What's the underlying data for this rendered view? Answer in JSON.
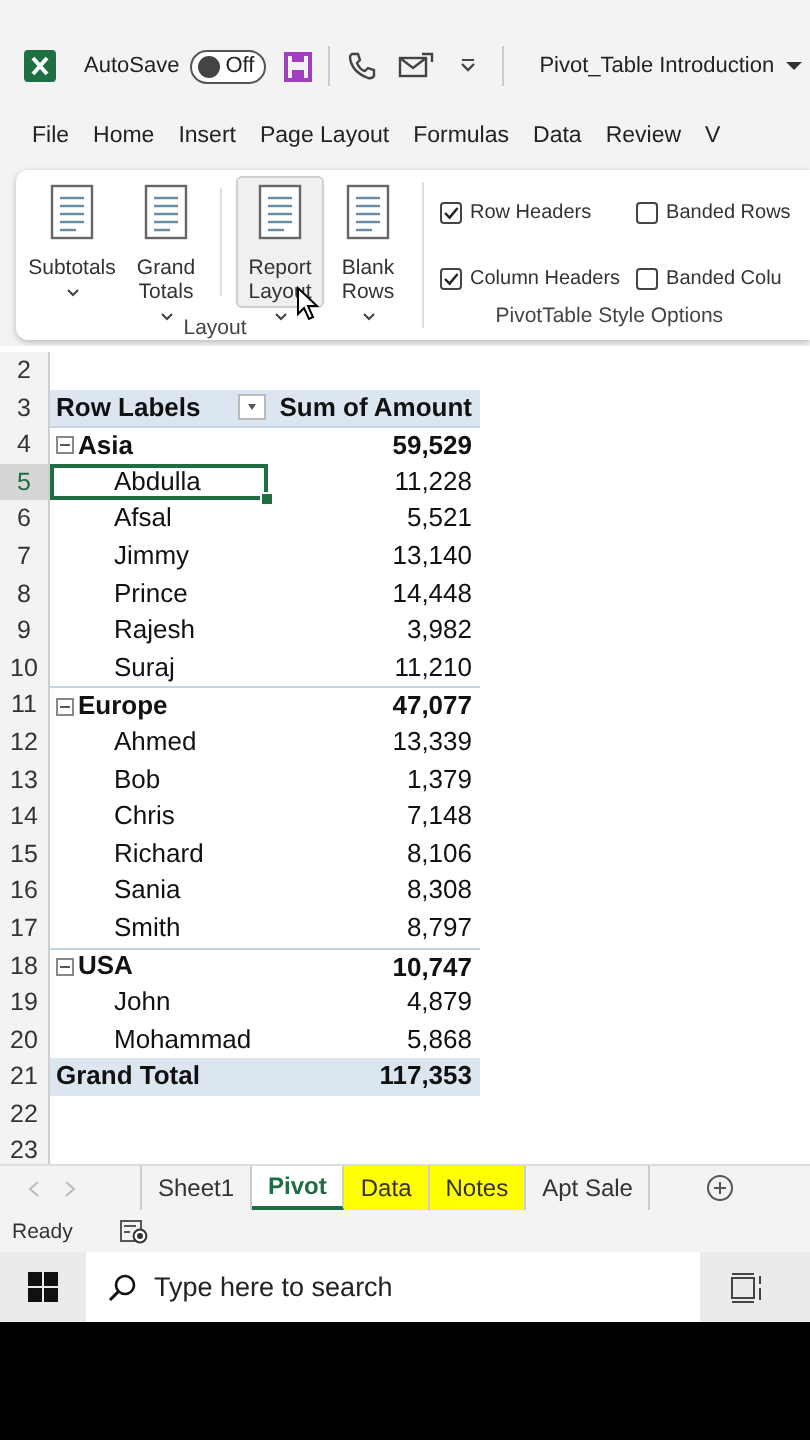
{
  "title_bar": {
    "autosave_label": "AutoSave",
    "autosave": {
      "on": false,
      "label": "Off"
    },
    "title": "Pivot_Table Introduction"
  },
  "menu_tabs": [
    {
      "label": "File",
      "selected": false
    },
    {
      "label": "Home",
      "selected": false
    },
    {
      "label": "Insert",
      "selected": false
    },
    {
      "label": "Page Layout",
      "selected": false
    },
    {
      "label": "Formulas",
      "selected": false
    },
    {
      "label": "Data",
      "selected": false
    },
    {
      "label": "Review",
      "selected": false
    },
    {
      "label": "V",
      "selected": false
    }
  ],
  "ribbon": {
    "layout_group": {
      "label": "Layout",
      "buttons": [
        {
          "label": "Subtotals",
          "highlighted": false
        },
        {
          "label": "Grand Totals",
          "highlighted": false
        },
        {
          "label": "Report Layout",
          "highlighted": true
        },
        {
          "label": "Blank Rows",
          "highlighted": false
        }
      ]
    },
    "style_group": {
      "label": "PivotTable Style Options",
      "options": [
        {
          "label": "Row Headers",
          "checked": true
        },
        {
          "label": "Banded Rows",
          "checked": false
        },
        {
          "label": "Column Headers",
          "checked": true
        },
        {
          "label": "Banded Colu",
          "checked": false
        }
      ]
    }
  },
  "sheet": {
    "rows": [
      {
        "number": "2",
        "kind": "blank",
        "selected": false
      },
      {
        "number": "3",
        "kind": "header",
        "label": "Row Labels",
        "value": "Sum of Amount",
        "selected": false
      },
      {
        "number": "4",
        "kind": "group",
        "label": "Asia",
        "value": "59,529",
        "expanded": true,
        "selected": false
      },
      {
        "number": "5",
        "kind": "item",
        "label": "Abdulla",
        "value": "11,228",
        "selected": true
      },
      {
        "number": "6",
        "kind": "item",
        "label": "Afsal",
        "value": "5,521",
        "selected": false
      },
      {
        "number": "7",
        "kind": "item",
        "label": "Jimmy",
        "value": "13,140",
        "selected": false
      },
      {
        "number": "8",
        "kind": "item",
        "label": "Prince",
        "value": "14,448",
        "selected": false
      },
      {
        "number": "9",
        "kind": "item",
        "label": "Rajesh",
        "value": "3,982",
        "selected": false
      },
      {
        "number": "10",
        "kind": "item",
        "label": "Suraj",
        "value": "11,210",
        "selected": false
      },
      {
        "number": "11",
        "kind": "group",
        "label": "Europe",
        "value": "47,077",
        "expanded": true,
        "selected": false
      },
      {
        "number": "12",
        "kind": "item",
        "label": "Ahmed",
        "value": "13,339",
        "selected": false
      },
      {
        "number": "13",
        "kind": "item",
        "label": "Bob",
        "value": "1,379",
        "selected": false
      },
      {
        "number": "14",
        "kind": "item",
        "label": "Chris",
        "value": "7,148",
        "selected": false
      },
      {
        "number": "15",
        "kind": "item",
        "label": "Richard",
        "value": "8,106",
        "selected": false
      },
      {
        "number": "16",
        "kind": "item",
        "label": "Sania",
        "value": "8,308",
        "selected": false
      },
      {
        "number": "17",
        "kind": "item",
        "label": "Smith",
        "value": "8,797",
        "selected": false
      },
      {
        "number": "18",
        "kind": "group",
        "label": "USA",
        "value": "10,747",
        "expanded": true,
        "selected": false
      },
      {
        "number": "19",
        "kind": "item",
        "label": "John",
        "value": "4,879",
        "selected": false
      },
      {
        "number": "20",
        "kind": "item",
        "label": "Mohammad",
        "value": "5,868",
        "selected": false
      },
      {
        "number": "21",
        "kind": "total",
        "label": "Grand Total",
        "value": "117,353",
        "selected": false
      },
      {
        "number": "22",
        "kind": "blank",
        "selected": false
      },
      {
        "number": "23",
        "kind": "blank",
        "selected": false
      }
    ]
  },
  "sheet_tabs": [
    {
      "label": "Sheet1",
      "selected": false
    },
    {
      "label": "Pivot",
      "selected": true
    },
    {
      "label": "Data",
      "selected": false,
      "color": "#ffff00"
    },
    {
      "label": "Notes",
      "selected": false,
      "color": "#ffff00"
    },
    {
      "label": "Apt Sale",
      "selected": false
    }
  ],
  "status_bar": {
    "status": "Ready"
  },
  "taskbar": {
    "search": {
      "placeholder": "Type here to search"
    }
  }
}
